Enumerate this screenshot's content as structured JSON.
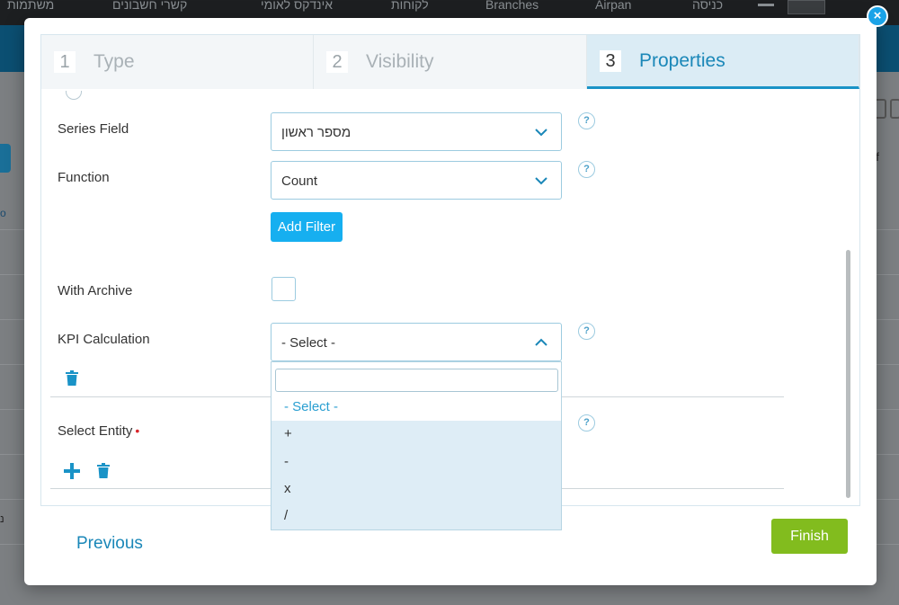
{
  "background_app": {
    "nav_items": [
      "משתמות",
      "קשרי חשבונים",
      "אינדקס לאומי",
      "לקוחות",
      "Branches",
      "Airpan",
      "כניסה"
    ],
    "list_text_of": "of",
    "side_text": "o",
    "row_text": "נ"
  },
  "wizard": {
    "steps": [
      {
        "number": "1",
        "label": "Type",
        "active": false
      },
      {
        "number": "2",
        "label": "Visibility",
        "active": false
      },
      {
        "number": "3",
        "label": "Properties",
        "active": true
      }
    ]
  },
  "form": {
    "series_field": {
      "label": "Series Field",
      "value": "מספר ראשון"
    },
    "function": {
      "label": "Function",
      "value": "Count"
    },
    "add_filter_label": "Add Filter",
    "with_archive": {
      "label": "With Archive",
      "checked": false
    },
    "kpi_calculation": {
      "label": "KPI Calculation",
      "value": "- Select -"
    },
    "select_entity": {
      "label": "Select Entity",
      "required_mark": "•"
    },
    "help_glyph": "?"
  },
  "dropdown": {
    "search_value": "",
    "options": [
      "- Select -",
      "+",
      "-",
      "x",
      "/"
    ]
  },
  "footer": {
    "previous_label": "Previous",
    "finish_label": "Finish"
  },
  "close_glyph": "×",
  "colors": {
    "accent": "#16aff0",
    "step_active_text": "#1a87b8",
    "finish": "#82bc1e",
    "required": "#d9262b"
  }
}
